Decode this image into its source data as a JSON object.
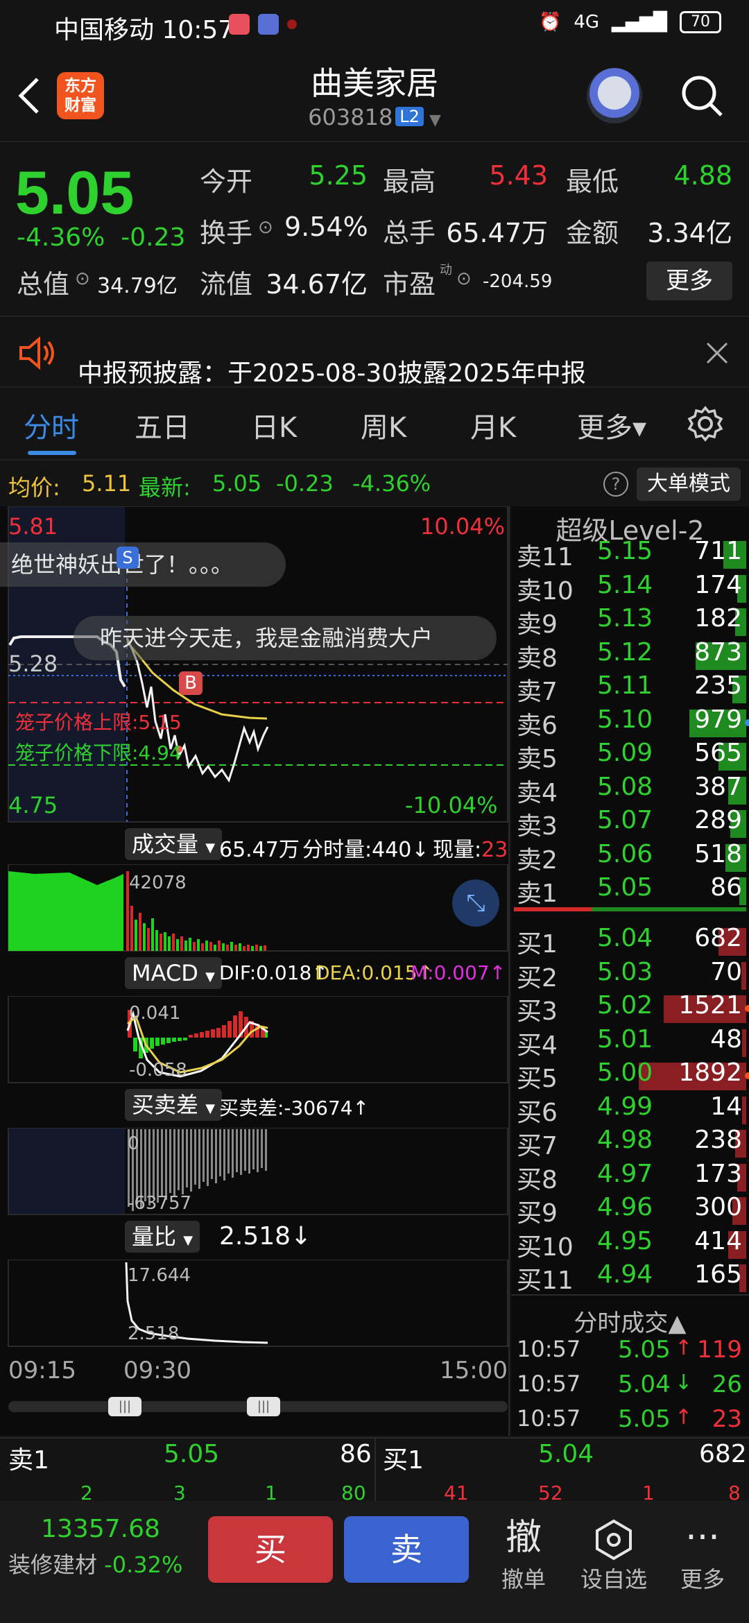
{
  "status_bar": {
    "carrier_time": "中国移动 10:57",
    "network": "4G",
    "battery": "70"
  },
  "header": {
    "logo_text": "东方\n财富",
    "stock_name": "曲美家居",
    "stock_code": "603818",
    "level_badge": "L2"
  },
  "quote": {
    "price": "5.05",
    "change_pct": "-4.36%",
    "change_amt": "-0.23",
    "open_label": "今开",
    "open": "5.25",
    "high_label": "最高",
    "high": "5.43",
    "low_label": "最低",
    "low": "4.88",
    "turnover_label": "换手",
    "turnover": "9.54%",
    "volume_label": "总手",
    "volume": "65.47万",
    "amount_label": "金额",
    "amount": "3.34亿",
    "mktcap_label": "总值",
    "mktcap": "34.79亿",
    "float_label": "流值",
    "float": "34.67亿",
    "pe_label": "市盈",
    "pe_sup": "动",
    "pe": "-204.59",
    "more_label": "更多"
  },
  "notice": {
    "text": "中报预披露：于2025-08-30披露2025年中报"
  },
  "tabs": [
    "分时",
    "五日",
    "日K",
    "周K",
    "月K",
    "更多▾"
  ],
  "avg_bar": {
    "avg_label": "均价:",
    "avg": "5.11",
    "latest_label": "最新:",
    "latest": "5.05",
    "chg": "-0.23",
    "pct": "-4.36%",
    "help": "?",
    "big_order_label": "大单模式"
  },
  "chart": {
    "top_price": "5.81",
    "top_pct": "10.04%",
    "mid_price": "5.28",
    "bottom_price": "4.75",
    "bottom_pct": "-10.04%",
    "bubble1": "绝世神妖出世了！。。。",
    "bubble2": "昨天进今天走，我是金融消费大户",
    "marker_s": "S",
    "marker_b": "B",
    "cage_upper": "笼子价格上限:5.15",
    "cage_lower": "笼子价格下限:4.94",
    "vol_tag": "成交量",
    "vol_total": "65.47万",
    "vol_split": "分时量:440↓",
    "vol_now_label": "现量:",
    "vol_now": "23",
    "vol_max": "42078",
    "macd_tag": "MACD",
    "dif": "DIF:0.018↑",
    "dea": "DEA:0.015↑",
    "m": "M:0.007↑",
    "macd_top": "0.041",
    "macd_bottom": "-0.058",
    "bs_tag": "买卖差",
    "bs_val": "买卖差:-30674↑",
    "bs_top": "0",
    "bs_bottom": "-63757",
    "vr_tag": "量比",
    "vr_val": "2.518↓",
    "vr_top": "17.644",
    "vr_bottom": "2.518",
    "time_start": "09:15",
    "time_open": "09:30",
    "time_end": "15:00"
  },
  "book": {
    "title": "超级Level-2",
    "asks": [
      {
        "lv": "卖11",
        "pr": "5.15",
        "vol": "711",
        "w": 0.1
      },
      {
        "lv": "卖10",
        "pr": "5.14",
        "vol": "174",
        "w": 0.04
      },
      {
        "lv": "卖9",
        "pr": "5.13",
        "vol": "182",
        "w": 0.05
      },
      {
        "lv": "卖8",
        "pr": "5.12",
        "vol": "873",
        "w": 0.22
      },
      {
        "lv": "卖7",
        "pr": "5.11",
        "vol": "235",
        "w": 0.06
      },
      {
        "lv": "卖6",
        "pr": "5.10",
        "vol": "979",
        "w": 0.25
      },
      {
        "lv": "卖5",
        "pr": "5.09",
        "vol": "565",
        "w": 0.12
      },
      {
        "lv": "卖4",
        "pr": "5.08",
        "vol": "387",
        "w": 0.08
      },
      {
        "lv": "卖3",
        "pr": "5.07",
        "vol": "289",
        "w": 0.07
      },
      {
        "lv": "卖2",
        "pr": "5.06",
        "vol": "518",
        "w": 0.09
      },
      {
        "lv": "卖1",
        "pr": "5.05",
        "vol": "86",
        "w": 0.03
      }
    ],
    "bids": [
      {
        "lv": "买1",
        "pr": "5.04",
        "vol": "682",
        "w": 0.12
      },
      {
        "lv": "买2",
        "pr": "5.03",
        "vol": "70",
        "w": 0.02
      },
      {
        "lv": "买3",
        "pr": "5.02",
        "vol": "1521",
        "w": 0.36
      },
      {
        "lv": "买4",
        "pr": "5.01",
        "vol": "48",
        "w": 0.01
      },
      {
        "lv": "买5",
        "pr": "5.00",
        "vol": "1892",
        "w": 0.47
      },
      {
        "lv": "买6",
        "pr": "4.99",
        "vol": "14",
        "w": 0.01
      },
      {
        "lv": "买7",
        "pr": "4.98",
        "vol": "238",
        "w": 0.05
      },
      {
        "lv": "买8",
        "pr": "4.97",
        "vol": "173",
        "w": 0.04
      },
      {
        "lv": "买9",
        "pr": "4.96",
        "vol": "300",
        "w": 0.06
      },
      {
        "lv": "买10",
        "pr": "4.95",
        "vol": "414",
        "w": 0.08
      },
      {
        "lv": "买11",
        "pr": "4.94",
        "vol": "165",
        "w": 0.03
      }
    ],
    "ticks_title": "分时成交▲",
    "ticks": [
      {
        "t": "10:57",
        "p": "5.05",
        "a": "↑",
        "v": "119",
        "c": "red"
      },
      {
        "t": "10:57",
        "p": "5.04",
        "a": "↓",
        "v": "26",
        "c": "green"
      },
      {
        "t": "10:57",
        "p": "5.05",
        "a": "↑",
        "v": "23",
        "c": "red"
      }
    ]
  },
  "compare": {
    "sell_label": "卖1",
    "sell_price": "5.05",
    "sell_vol": "86",
    "buy_label": "买1",
    "buy_price": "5.04",
    "buy_vol": "682",
    "row2_left": [
      "2",
      "3",
      "1",
      "80"
    ],
    "row2_right": [
      "41",
      "52",
      "1",
      "8"
    ]
  },
  "bottom_nav": {
    "index_value": "13357.68",
    "index_name": "装修建材",
    "index_chg": "-0.32%",
    "buy_label": "买",
    "sell_label": "卖",
    "cancel_glyph": "撤",
    "cancel_label": "撤单",
    "fav_label": "设自选",
    "more_glyph": "···",
    "more_label": "更多"
  },
  "colors": {
    "up": "#f0303a",
    "down": "#2ed12e",
    "accent": "#3b8ae6",
    "bg": "#141414"
  }
}
